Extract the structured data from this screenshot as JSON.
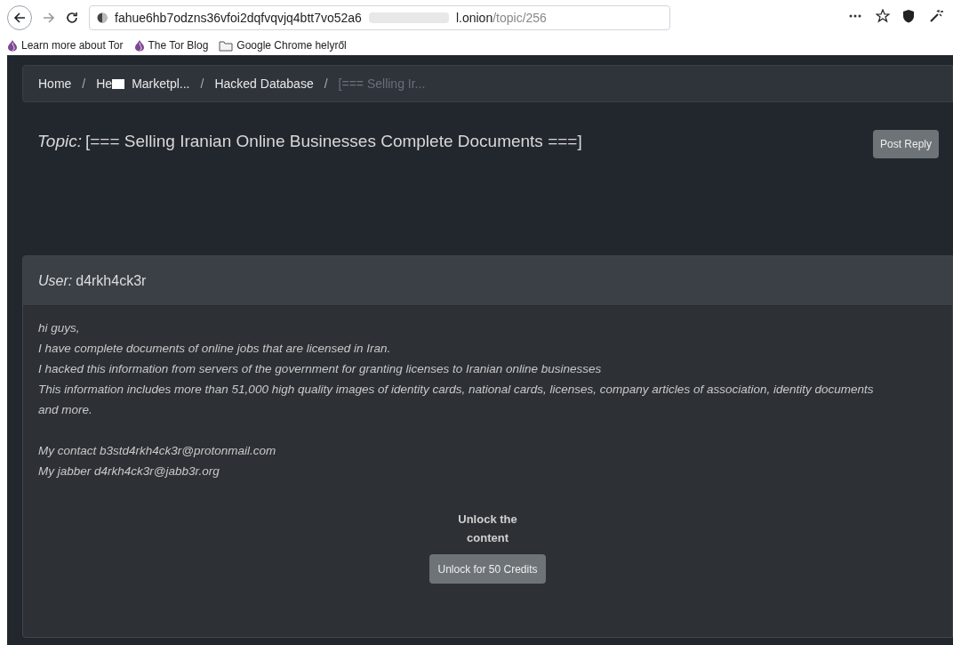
{
  "browser": {
    "url_host_start": "fahue6hb7odzns36vfoi2dqfvqvjq4btt7vo52a6",
    "url_host_end": "l.onion",
    "url_path": "/topic/256",
    "bookmarks": [
      {
        "label": "Learn more about Tor",
        "kind": "onion"
      },
      {
        "label": "The Tor Blog",
        "kind": "onion"
      },
      {
        "label": "Google Chrome helyről",
        "kind": "folder"
      }
    ]
  },
  "breadcrumb": [
    {
      "label": "Home",
      "current": false
    },
    {
      "label": "Marketpl...",
      "current": false,
      "redacted_prefix": "He"
    },
    {
      "label": "Hacked Database",
      "current": false
    },
    {
      "label": "[=== Selling Ir...",
      "current": true
    }
  ],
  "breadcrumb_separator": "/",
  "topic": {
    "label": "Topic:",
    "title": "[=== Selling Iranian Online Businesses Complete Documents ===]",
    "button": "Post Reply"
  },
  "post": {
    "user_label": "User:",
    "user": "d4rkh4ck3r",
    "paragraphs": [
      [
        "hi guys,",
        "I have complete documents of online jobs that are licensed in Iran.",
        "I hacked this information from servers of the government for granting licenses to Iranian online businesses",
        "This information includes more than 51,000 high quality images of identity cards, national cards, licenses, company articles of association, identity documents and more."
      ],
      [
        "My contact b3std4rkh4ck3r@protonmail.com",
        "My jabber d4rkh4ck3r@jabb3r.org"
      ]
    ],
    "unlock_title": "Unlock the content",
    "unlock_button": "Unlock for 50 Credits"
  }
}
